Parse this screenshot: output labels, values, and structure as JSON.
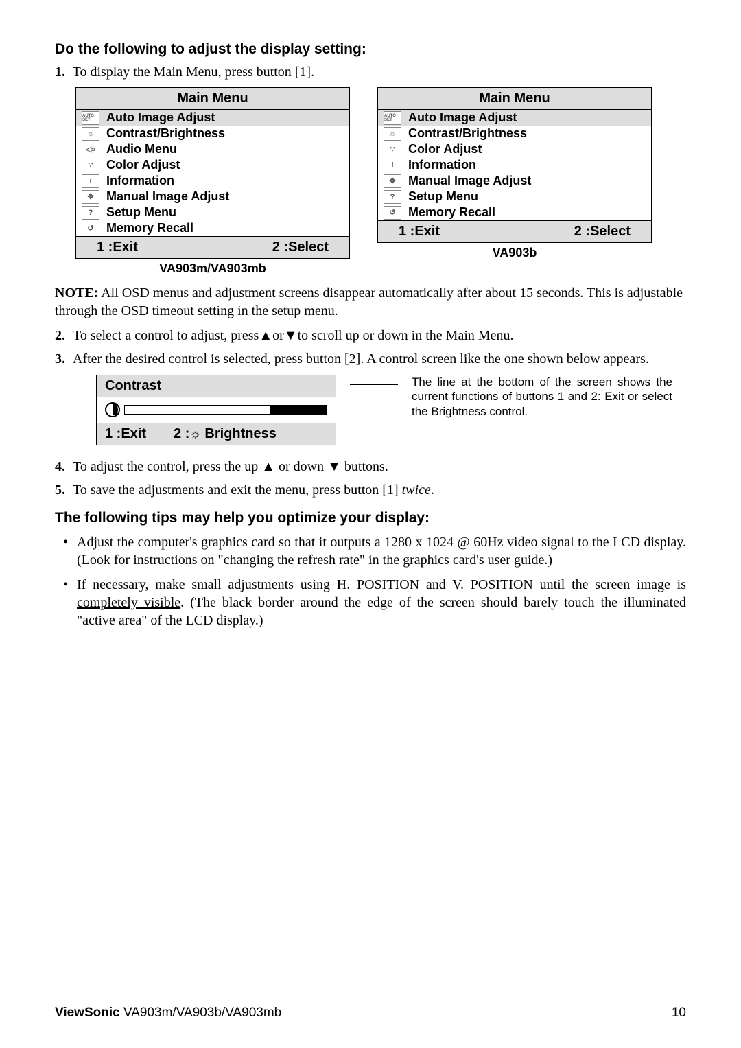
{
  "section1_title": "Do the following to adjust the display setting:",
  "step1": {
    "num": "1.",
    "text": "To display the Main Menu, press button [1]."
  },
  "menu_left": {
    "title": "Main Menu",
    "items": [
      {
        "icon": "AUTO SET",
        "label": "Auto Image Adjust",
        "selected": true,
        "iname": "auto-set-icon"
      },
      {
        "icon": "☼",
        "label": "Contrast/Brightness",
        "iname": "brightness-icon"
      },
      {
        "icon": "◁»",
        "label": "Audio Menu",
        "iname": "audio-icon"
      },
      {
        "icon": "∵",
        "label": "Color Adjust",
        "iname": "color-icon"
      },
      {
        "icon": "i",
        "label": "Information",
        "iname": "info-icon"
      },
      {
        "icon": "✥",
        "label": "Manual Image Adjust",
        "iname": "move-icon"
      },
      {
        "icon": "?",
        "label": "Setup Menu",
        "iname": "question-icon"
      },
      {
        "icon": "↺",
        "label": "Memory Recall",
        "iname": "recall-icon"
      }
    ],
    "footer_left": "1 :Exit",
    "footer_right": "2 :Select",
    "caption": "VA903m/VA903mb"
  },
  "menu_right": {
    "title": "Main Menu",
    "items": [
      {
        "icon": "AUTO SET",
        "label": "Auto Image Adjust",
        "selected": true,
        "iname": "auto-set-icon"
      },
      {
        "icon": "☼",
        "label": "Contrast/Brightness",
        "iname": "brightness-icon"
      },
      {
        "icon": "∵",
        "label": "Color Adjust",
        "iname": "color-icon"
      },
      {
        "icon": "i",
        "label": "Information",
        "iname": "info-icon"
      },
      {
        "icon": "✥",
        "label": "Manual Image Adjust",
        "iname": "move-icon"
      },
      {
        "icon": "?",
        "label": "Setup Menu",
        "iname": "question-icon"
      },
      {
        "icon": "↺",
        "label": "Memory Recall",
        "iname": "recall-icon"
      }
    ],
    "footer_left": "1 :Exit",
    "footer_right": "2 :Select",
    "caption": "VA903b"
  },
  "note_label": "NOTE:",
  "note_text": " All OSD menus and adjustment screens disappear automatically after about 15 seconds. This is adjustable through the OSD timeout setting in the setup menu.",
  "step2": {
    "num": "2.",
    "pre": "To select a control to adjust, press",
    "mid": "or",
    "post": "to scroll up or down in the Main Menu."
  },
  "step3": {
    "num": "3.",
    "text": "After the desired control is selected, press button [2]. A control screen like the one shown below appears."
  },
  "contrast": {
    "label": "Contrast",
    "footer_left": "1 :Exit",
    "footer_right_pre": "2 :",
    "footer_right_post": " Brightness"
  },
  "callout": "The line at the bottom of the screen shows the current functions of buttons 1 and 2: Exit or select the Brightness control.",
  "step4": {
    "num": "4.",
    "pre": "To adjust the control, press the up ",
    "mid": " or down ",
    "post": " buttons."
  },
  "step5": {
    "num": "5.",
    "pre": "To save the adjustments and exit the menu, press button [1] ",
    "ital": "twice",
    "post": "."
  },
  "section2_title": "The following tips may help you optimize your display:",
  "tip1": "Adjust the computer's graphics card so that it outputs a 1280 x 1024 @ 60Hz video signal to the LCD display. (Look for instructions on \"changing the refresh rate\" in the graphics card's user guide.)",
  "tip2_pre": "If necessary, make small adjustments using H. POSITION and V. POSITION until the screen image is ",
  "tip2_u": "completely visible",
  "tip2_post": ". (The black border around the edge of the screen should barely touch the illuminated \"active area\" of the LCD display.)",
  "footer": {
    "brand": "ViewSonic",
    "model": "   VA903m/VA903b/VA903mb",
    "page": "10"
  },
  "glyphs": {
    "up": "▲",
    "down": "▼",
    "sun": "☼"
  }
}
